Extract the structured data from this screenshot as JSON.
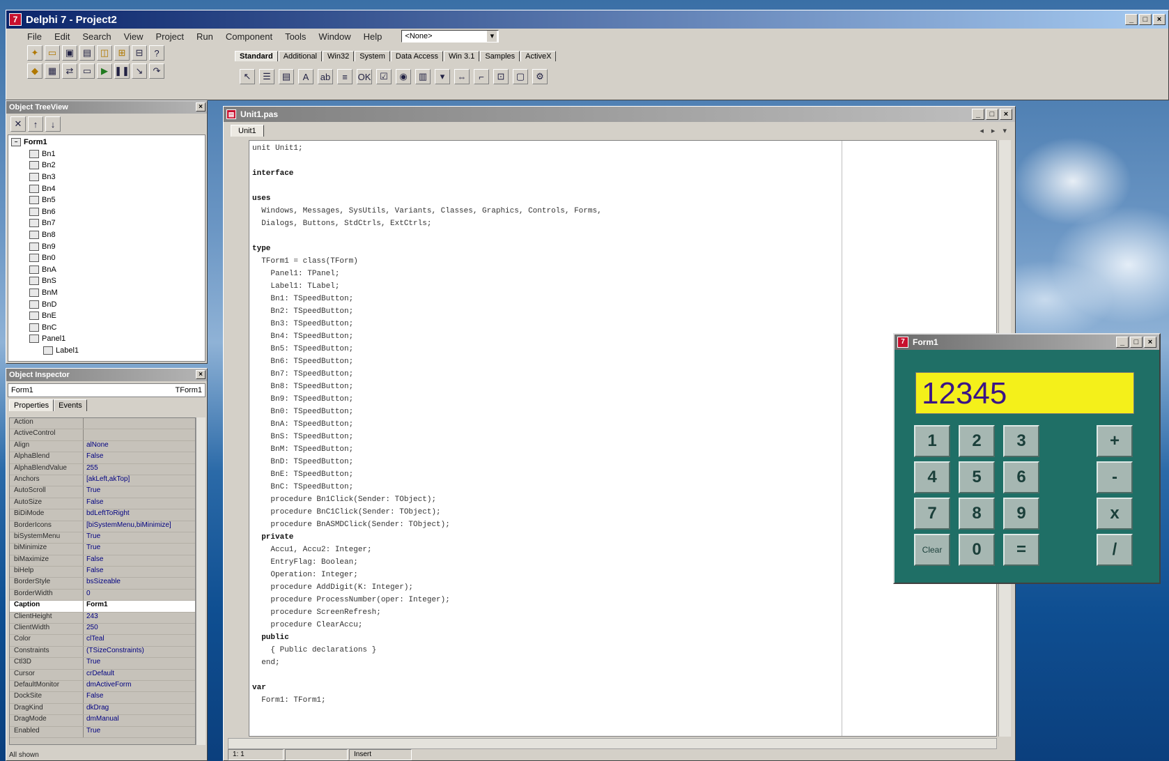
{
  "ide": {
    "title": "Delphi 7 - Project2",
    "menu": [
      "File",
      "Edit",
      "Search",
      "View",
      "Project",
      "Run",
      "Component",
      "Tools",
      "Window",
      "Help"
    ],
    "desktop_combo": "<None>",
    "palette_tabs": [
      "Standard",
      "Additional",
      "Win32",
      "System",
      "Data Access",
      "Win 3.1",
      "Samples",
      "ActiveX"
    ]
  },
  "tree": {
    "title": "Object TreeView",
    "root": "Form1",
    "items": [
      "Bn1",
      "Bn2",
      "Bn3",
      "Bn4",
      "Bn5",
      "Bn6",
      "Bn7",
      "Bn8",
      "Bn9",
      "Bn0",
      "BnA",
      "BnS",
      "BnM",
      "BnD",
      "BnE",
      "BnC",
      "Panel1"
    ],
    "sub": "Label1"
  },
  "inspector": {
    "title": "Object Inspector",
    "object": "Form1",
    "object_type": "TForm1",
    "tabs": [
      "Properties",
      "Events"
    ],
    "properties": [
      {
        "name": "Action",
        "value": ""
      },
      {
        "name": "ActiveControl",
        "value": ""
      },
      {
        "name": "Align",
        "value": "alNone"
      },
      {
        "name": "AlphaBlend",
        "value": "False"
      },
      {
        "name": "AlphaBlendValue",
        "value": "255"
      },
      {
        "name": "Anchors",
        "value": "[akLeft,akTop]"
      },
      {
        "name": "AutoScroll",
        "value": "True"
      },
      {
        "name": "AutoSize",
        "value": "False"
      },
      {
        "name": "BiDiMode",
        "value": "bdLeftToRight"
      },
      {
        "name": "BorderIcons",
        "value": "[biSystemMenu,biMinimize]"
      },
      {
        "name": "biSystemMenu",
        "value": "True"
      },
      {
        "name": "biMinimize",
        "value": "True"
      },
      {
        "name": "biMaximize",
        "value": "False"
      },
      {
        "name": "biHelp",
        "value": "False"
      },
      {
        "name": "BorderStyle",
        "value": "bsSizeable"
      },
      {
        "name": "BorderWidth",
        "value": "0"
      },
      {
        "name": "Caption",
        "value": "Form1"
      },
      {
        "name": "ClientHeight",
        "value": "243"
      },
      {
        "name": "ClientWidth",
        "value": "250"
      },
      {
        "name": "Color",
        "value": "clTeal"
      },
      {
        "name": "Constraints",
        "value": "(TSizeConstraints)"
      },
      {
        "name": "Ctl3D",
        "value": "True"
      },
      {
        "name": "Cursor",
        "value": "crDefault"
      },
      {
        "name": "DefaultMonitor",
        "value": "dmActiveForm"
      },
      {
        "name": "DockSite",
        "value": "False"
      },
      {
        "name": "DragKind",
        "value": "dkDrag"
      },
      {
        "name": "DragMode",
        "value": "dmManual"
      },
      {
        "name": "Enabled",
        "value": "True"
      }
    ],
    "selected_index": 16,
    "status": "All shown"
  },
  "editor": {
    "title": "Unit1.pas",
    "tab": "Unit1",
    "lines": [
      {
        "t": "unit Unit1;",
        "kw": false
      },
      {
        "t": "",
        "kw": false
      },
      {
        "t": "interface",
        "kw": true
      },
      {
        "t": "",
        "kw": false
      },
      {
        "t": "uses",
        "kw": true
      },
      {
        "t": "  Windows, Messages, SysUtils, Variants, Classes, Graphics, Controls, Forms,",
        "kw": false
      },
      {
        "t": "  Dialogs, Buttons, StdCtrls, ExtCtrls;",
        "kw": false
      },
      {
        "t": "",
        "kw": false
      },
      {
        "t": "type",
        "kw": true
      },
      {
        "t": "  TForm1 = class(TForm)",
        "kw": false
      },
      {
        "t": "    Panel1: TPanel;",
        "kw": false
      },
      {
        "t": "    Label1: TLabel;",
        "kw": false
      },
      {
        "t": "    Bn1: TSpeedButton;",
        "kw": false
      },
      {
        "t": "    Bn2: TSpeedButton;",
        "kw": false
      },
      {
        "t": "    Bn3: TSpeedButton;",
        "kw": false
      },
      {
        "t": "    Bn4: TSpeedButton;",
        "kw": false
      },
      {
        "t": "    Bn5: TSpeedButton;",
        "kw": false
      },
      {
        "t": "    Bn6: TSpeedButton;",
        "kw": false
      },
      {
        "t": "    Bn7: TSpeedButton;",
        "kw": false
      },
      {
        "t": "    Bn8: TSpeedButton;",
        "kw": false
      },
      {
        "t": "    Bn9: TSpeedButton;",
        "kw": false
      },
      {
        "t": "    Bn0: TSpeedButton;",
        "kw": false
      },
      {
        "t": "    BnA: TSpeedButton;",
        "kw": false
      },
      {
        "t": "    BnS: TSpeedButton;",
        "kw": false
      },
      {
        "t": "    BnM: TSpeedButton;",
        "kw": false
      },
      {
        "t": "    BnD: TSpeedButton;",
        "kw": false
      },
      {
        "t": "    BnE: TSpeedButton;",
        "kw": false
      },
      {
        "t": "    BnC: TSpeedButton;",
        "kw": false
      },
      {
        "t": "    procedure Bn1Click(Sender: TObject);",
        "kw": false
      },
      {
        "t": "    procedure BnC1Click(Sender: TObject);",
        "kw": false
      },
      {
        "t": "    procedure BnASMDClick(Sender: TObject);",
        "kw": false
      },
      {
        "t": "  private",
        "kw": true
      },
      {
        "t": "    Accu1, Accu2: Integer;",
        "kw": false
      },
      {
        "t": "    EntryFlag: Boolean;",
        "kw": false
      },
      {
        "t": "    Operation: Integer;",
        "kw": false
      },
      {
        "t": "    procedure AddDigit(K: Integer);",
        "kw": false
      },
      {
        "t": "    procedure ProcessNumber(oper: Integer);",
        "kw": false
      },
      {
        "t": "    procedure ScreenRefresh;",
        "kw": false
      },
      {
        "t": "    procedure ClearAccu;",
        "kw": false
      },
      {
        "t": "  public",
        "kw": true
      },
      {
        "t": "    { Public declarations }",
        "kw": false
      },
      {
        "t": "  end;",
        "kw": false
      },
      {
        "t": "",
        "kw": false
      },
      {
        "t": "var",
        "kw": true
      },
      {
        "t": "  Form1: TForm1;",
        "kw": false
      }
    ],
    "status": {
      "pos": "1: 1",
      "mode": "Insert"
    }
  },
  "calc": {
    "title": "Form1",
    "display": "12345",
    "display_color": "#f4f01a",
    "form_color": "#1f6f66",
    "keys": [
      {
        "label": "1",
        "name": "key-1"
      },
      {
        "label": "2",
        "name": "key-2"
      },
      {
        "label": "3",
        "name": "key-3"
      },
      {
        "label": "+",
        "name": "key-add"
      },
      {
        "label": "4",
        "name": "key-4"
      },
      {
        "label": "5",
        "name": "key-5"
      },
      {
        "label": "6",
        "name": "key-6"
      },
      {
        "label": "-",
        "name": "key-subtract"
      },
      {
        "label": "7",
        "name": "key-7"
      },
      {
        "label": "8",
        "name": "key-8"
      },
      {
        "label": "9",
        "name": "key-9"
      },
      {
        "label": "x",
        "name": "key-multiply"
      },
      {
        "label": "Clear",
        "name": "key-clear"
      },
      {
        "label": "0",
        "name": "key-0"
      },
      {
        "label": "=",
        "name": "key-equals"
      },
      {
        "label": "/",
        "name": "key-divide"
      }
    ]
  }
}
